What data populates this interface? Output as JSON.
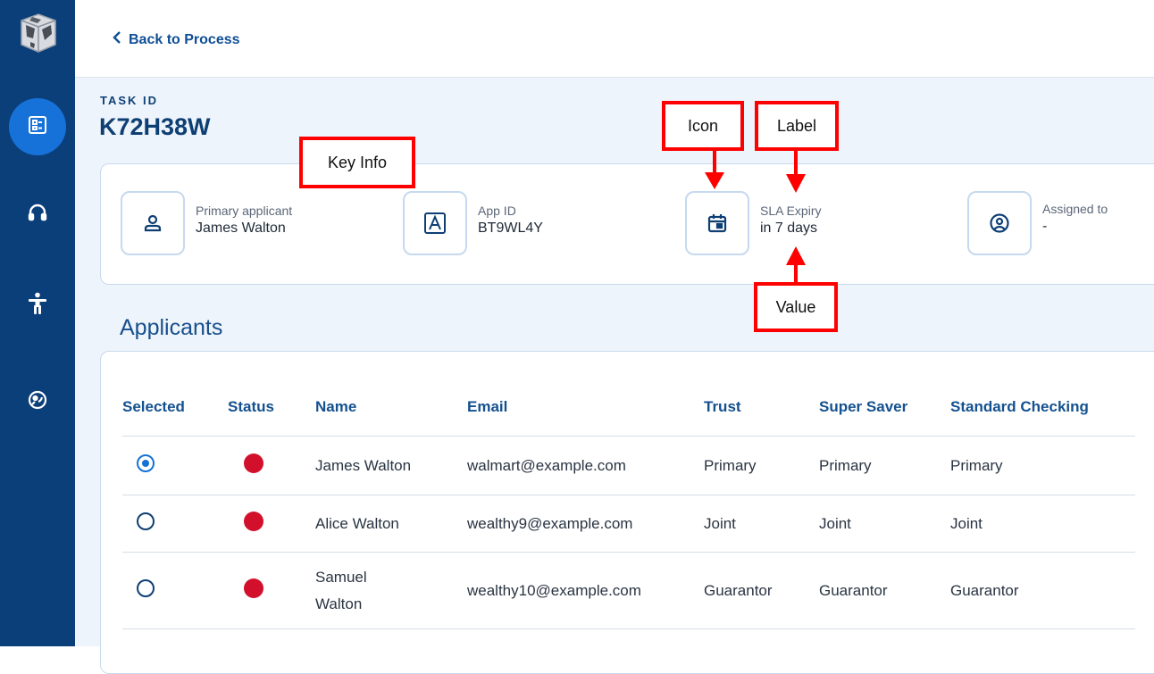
{
  "nav": {
    "back_label": "Back to Process",
    "sidebar_icons": [
      "globe-logo",
      "task-icon",
      "headset-icon",
      "accessibility-icon",
      "support-icon"
    ]
  },
  "task": {
    "label": "TASK ID",
    "id": "K72H38W"
  },
  "key_info": [
    {
      "icon": "person-icon",
      "label": "Primary applicant",
      "value": "James Walton"
    },
    {
      "icon": "app-letter-icon",
      "label": "App ID",
      "value": "BT9WL4Y"
    },
    {
      "icon": "calendar-icon",
      "label": "SLA Expiry",
      "value": "in 7 days"
    },
    {
      "icon": "user-circle-icon",
      "label": "Assigned to",
      "value": "-"
    }
  ],
  "applicants": {
    "title": "Applicants",
    "columns": [
      "Selected",
      "Status",
      "Name",
      "Email",
      "Trust",
      "Super Saver",
      "Standard Checking"
    ],
    "rows": [
      {
        "selected": true,
        "status": "red",
        "name": "James Walton",
        "email": "walmart@example.com",
        "trust": "Primary",
        "super_saver": "Primary",
        "standard_checking": "Primary"
      },
      {
        "selected": false,
        "status": "red",
        "name": "Alice Walton",
        "email": "wealthy9@example.com",
        "trust": "Joint",
        "super_saver": "Joint",
        "standard_checking": "Joint"
      },
      {
        "selected": false,
        "status": "red",
        "name": "Samuel Walton",
        "email": "wealthy10@example.com",
        "trust": "Guarantor",
        "super_saver": "Guarantor",
        "standard_checking": "Guarantor"
      }
    ]
  },
  "annotations": {
    "key_info": "Key Info",
    "icon": "Icon",
    "label": "Label",
    "value": "Value"
  },
  "colors": {
    "sidebar": "#0b3f7a",
    "accent": "#1672d8",
    "heading": "#14518f",
    "status_red": "#d2102c",
    "callout_red": "#ff0000"
  }
}
